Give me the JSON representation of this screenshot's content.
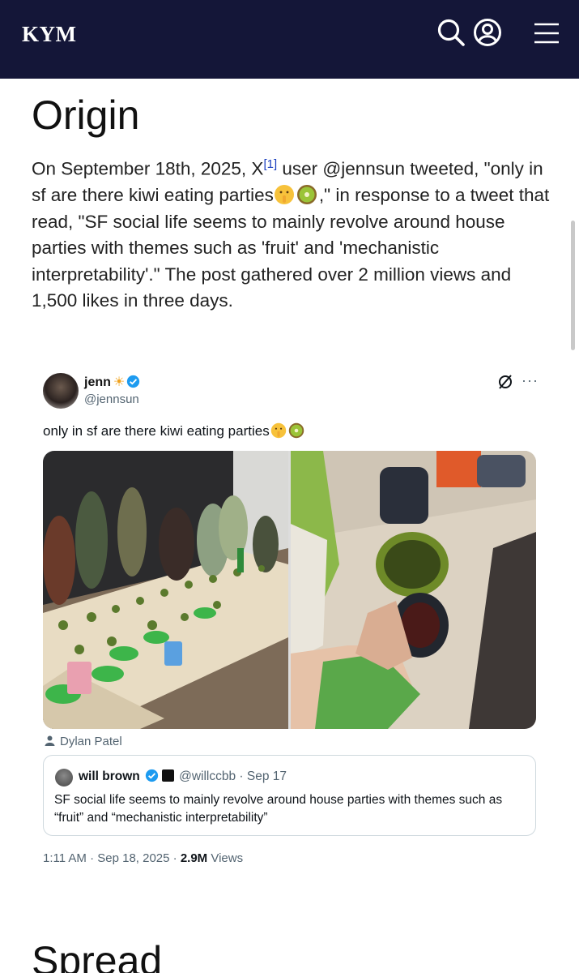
{
  "header": {
    "logo": "KYM",
    "icons": [
      "search-icon",
      "user-icon",
      "menu-icon"
    ],
    "background": "#141638"
  },
  "article": {
    "origin_heading": "Origin",
    "paragraph": {
      "part1": "On September 18th, 2025, X",
      "ref": "[1]",
      "part2": " user @jennsun tweeted, \"only in sf are there kiwi eating parties",
      "part3": ",\" in response to a tweet that read, \"SF social life seems to mainly revolve around house parties with themes such as 'fruit' and 'mechanistic interpretability'.\" The post gathered over 2 million views and 1,500 likes in three days."
    },
    "spread_heading": "Spread"
  },
  "tweet": {
    "name": "jenn",
    "name_emoji": "☀",
    "handle": "@jennsun",
    "text": "only in sf are there kiwi eating parties",
    "emojis": [
      "shushing-face-emoji",
      "kiwi-emoji"
    ],
    "photo_credit": "Dylan Patel",
    "quote": {
      "name": "will brown",
      "handle": "@willccbb",
      "date": "· Sep 17",
      "text": "SF social life seems to mainly revolve around house parties with themes such as “fruit” and “mechanistic interpretability”"
    },
    "time": "1:11 AM · Sep 18, 2025 · ",
    "views_count": "2.9M",
    "views_label": " Views"
  },
  "colors": {
    "link": "#1a3fbf",
    "verified": "#1d9bf0",
    "muted": "#536471"
  }
}
